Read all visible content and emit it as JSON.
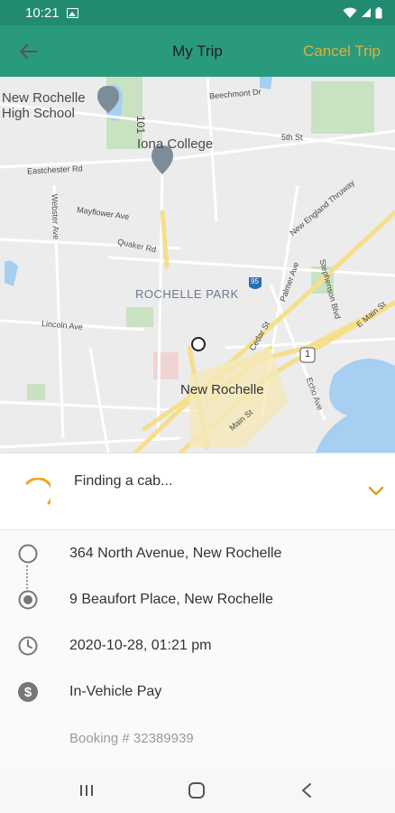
{
  "status_bar": {
    "time": "10:21",
    "icons": [
      "image-icon",
      "wifi-icon",
      "signal-icon",
      "battery-icon"
    ]
  },
  "app_bar": {
    "title": "My Trip",
    "cancel_label": "Cancel Trip",
    "back_icon": "arrow-left-icon"
  },
  "map": {
    "labels": {
      "new_rochelle_hs": "New Rochelle High School",
      "iona": "Iona College",
      "rochelle_park": "ROCHELLE PARK",
      "new_rochelle": "New Rochelle",
      "beechmont": "Beechmont Dr",
      "fifth_st": "5th St",
      "thruway": "New England Thruway",
      "palmer": "Palmer Ave",
      "stephenson": "Stephenson Blvd",
      "e_main": "E Main St",
      "cedar": "Cedar St",
      "echo": "Echo Ave",
      "main": "Main St",
      "webster": "Webster Ave",
      "mayflower": "Mayflower Ave",
      "lincoln": "Lincoln Ave",
      "eastchester": "Eastchester Rd",
      "route_101": "101",
      "interstate_95": "95",
      "us_1": "1",
      "quaker": "Quaker Rd"
    }
  },
  "trip": {
    "status": "Finding a cab...",
    "pickup": "364 North Avenue, New Rochelle",
    "dropoff": "9 Beaufort Place, New Rochelle",
    "datetime": "2020-10-28, 01:21 pm",
    "payment": "In-Vehicle Pay",
    "booking": "Booking # 32389939"
  },
  "colors": {
    "primary": "#2a9a7d",
    "status_bar": "#228a70",
    "accent": "#d9b23c",
    "spinner": "#f0a526"
  },
  "nav_bar": {
    "icons": [
      "recent-apps-icon",
      "home-icon",
      "back-icon"
    ]
  }
}
